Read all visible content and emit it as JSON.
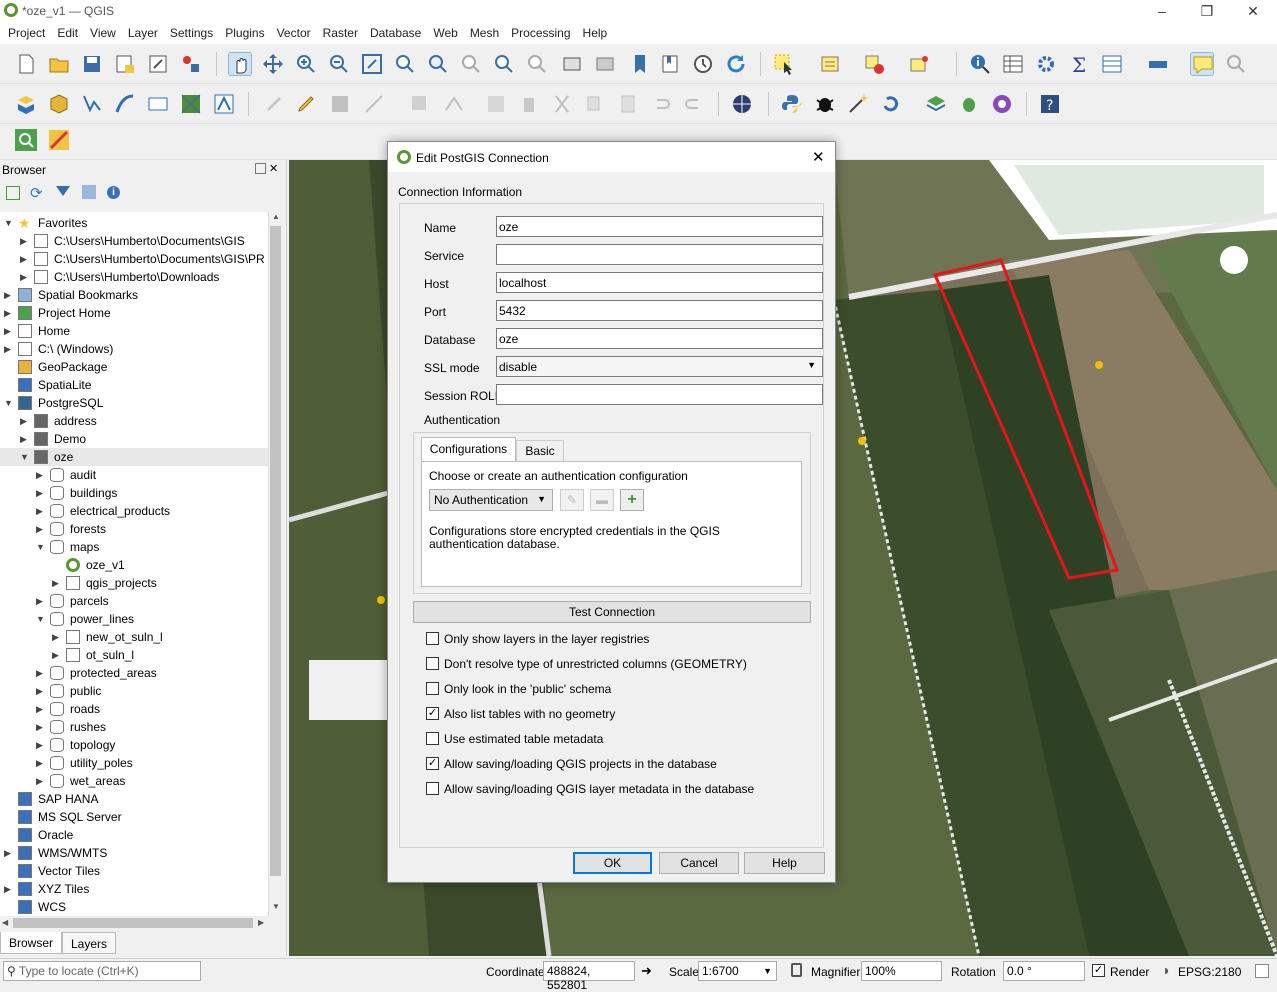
{
  "window": {
    "title": "*oze_v1 — QGIS"
  },
  "menu": [
    "Project",
    "Edit",
    "View",
    "Layer",
    "Settings",
    "Plugins",
    "Vector",
    "Raster",
    "Database",
    "Web",
    "Mesh",
    "Processing",
    "Help"
  ],
  "browser": {
    "title": "Browser",
    "items": [
      {
        "label": "Favorites",
        "depth": 0,
        "arrow": "down",
        "icon": "star-icon"
      },
      {
        "label": "C:\\Users\\Humberto\\Documents\\GIS",
        "depth": 1,
        "arrow": "right",
        "icon": "folder-icon"
      },
      {
        "label": "C:\\Users\\Humberto\\Documents\\GIS\\PR",
        "depth": 1,
        "arrow": "right",
        "icon": "folder-icon"
      },
      {
        "label": "C:\\Users\\Humberto\\Downloads",
        "depth": 1,
        "arrow": "right",
        "icon": "folder-icon"
      },
      {
        "label": "Spatial Bookmarks",
        "depth": 0,
        "arrow": "right",
        "icon": "bookmark-icon"
      },
      {
        "label": "Project Home",
        "depth": 0,
        "arrow": "right",
        "icon": "project-home-icon"
      },
      {
        "label": "Home",
        "depth": 0,
        "arrow": "right",
        "icon": "folder-icon"
      },
      {
        "label": "C:\\ (Windows)",
        "depth": 0,
        "arrow": "right",
        "icon": "folder-icon"
      },
      {
        "label": "GeoPackage",
        "depth": 0,
        "arrow": "",
        "icon": "geopackage-icon"
      },
      {
        "label": "SpatiaLite",
        "depth": 0,
        "arrow": "",
        "icon": "spatialite-icon"
      },
      {
        "label": "PostgreSQL",
        "depth": 0,
        "arrow": "down",
        "icon": "postgresql-icon"
      },
      {
        "label": "address",
        "depth": 1,
        "arrow": "right",
        "icon": "connection-icon"
      },
      {
        "label": "Demo",
        "depth": 1,
        "arrow": "right",
        "icon": "connection-icon"
      },
      {
        "label": "oze",
        "depth": 1,
        "arrow": "down",
        "icon": "connection-icon",
        "selected": true
      },
      {
        "label": "audit",
        "depth": 2,
        "arrow": "right",
        "icon": "schema-icon"
      },
      {
        "label": "buildings",
        "depth": 2,
        "arrow": "right",
        "icon": "schema-icon"
      },
      {
        "label": "electrical_products",
        "depth": 2,
        "arrow": "right",
        "icon": "schema-icon"
      },
      {
        "label": "forests",
        "depth": 2,
        "arrow": "right",
        "icon": "schema-icon"
      },
      {
        "label": "maps",
        "depth": 2,
        "arrow": "down",
        "icon": "schema-icon"
      },
      {
        "label": "oze_v1",
        "depth": 3,
        "arrow": "",
        "icon": "qgis-project-icon"
      },
      {
        "label": "qgis_projects",
        "depth": 3,
        "arrow": "right",
        "icon": "table-icon"
      },
      {
        "label": "parcels",
        "depth": 2,
        "arrow": "right",
        "icon": "schema-icon"
      },
      {
        "label": "power_lines",
        "depth": 2,
        "arrow": "down",
        "icon": "schema-icon"
      },
      {
        "label": "new_ot_suln_l",
        "depth": 3,
        "arrow": "right",
        "icon": "line-layer-icon"
      },
      {
        "label": "ot_suln_l",
        "depth": 3,
        "arrow": "right",
        "icon": "line-layer-icon"
      },
      {
        "label": "protected_areas",
        "depth": 2,
        "arrow": "right",
        "icon": "schema-icon"
      },
      {
        "label": "public",
        "depth": 2,
        "arrow": "right",
        "icon": "schema-icon"
      },
      {
        "label": "roads",
        "depth": 2,
        "arrow": "right",
        "icon": "schema-icon"
      },
      {
        "label": "rushes",
        "depth": 2,
        "arrow": "right",
        "icon": "schema-icon"
      },
      {
        "label": "topology",
        "depth": 2,
        "arrow": "right",
        "icon": "schema-icon"
      },
      {
        "label": "utility_poles",
        "depth": 2,
        "arrow": "right",
        "icon": "schema-icon"
      },
      {
        "label": "wet_areas",
        "depth": 2,
        "arrow": "right",
        "icon": "schema-icon"
      },
      {
        "label": "SAP HANA",
        "depth": 0,
        "arrow": "",
        "icon": "sap-hana-icon"
      },
      {
        "label": "MS SQL Server",
        "depth": 0,
        "arrow": "",
        "icon": "mssql-icon"
      },
      {
        "label": "Oracle",
        "depth": 0,
        "arrow": "",
        "icon": "oracle-icon"
      },
      {
        "label": "WMS/WMTS",
        "depth": 0,
        "arrow": "right",
        "icon": "wms-icon"
      },
      {
        "label": "Vector Tiles",
        "depth": 0,
        "arrow": "",
        "icon": "vector-tiles-icon"
      },
      {
        "label": "XYZ Tiles",
        "depth": 0,
        "arrow": "right",
        "icon": "xyz-tiles-icon"
      },
      {
        "label": "WCS",
        "depth": 0,
        "arrow": "",
        "icon": "wcs-icon"
      }
    ]
  },
  "panel_tabs": [
    "Browser",
    "Layers"
  ],
  "dialog": {
    "title": "Edit PostGIS Connection",
    "section": "Connection Information",
    "fields": [
      {
        "label": "Name",
        "value": "oze"
      },
      {
        "label": "Service",
        "value": ""
      },
      {
        "label": "Host",
        "value": "localhost"
      },
      {
        "label": "Port",
        "value": "5432"
      },
      {
        "label": "Database",
        "value": "oze"
      },
      {
        "label": "SSL mode",
        "value": "disable"
      },
      {
        "label": "Session ROLE",
        "value": ""
      }
    ],
    "auth": {
      "label": "Authentication",
      "tabs": [
        "Configurations",
        "Basic"
      ],
      "choose_label": "Choose or create an authentication configuration",
      "select_value": "No Authentication",
      "note": "Configurations store encrypted credentials in the QGIS authentication database."
    },
    "test_button": "Test Connection",
    "options": [
      {
        "label": "Only show layers in the layer registries",
        "checked": false
      },
      {
        "label": "Don't resolve type of unrestricted columns (GEOMETRY)",
        "checked": false
      },
      {
        "label": "Only look in the 'public' schema",
        "checked": false
      },
      {
        "label": "Also list tables with no geometry",
        "checked": true
      },
      {
        "label": "Use estimated table metadata",
        "checked": false
      },
      {
        "label": "Allow saving/loading QGIS projects in the database",
        "checked": true
      },
      {
        "label": "Allow saving/loading QGIS layer metadata in the database",
        "checked": false
      }
    ],
    "buttons": {
      "ok": "OK",
      "cancel": "Cancel",
      "help": "Help"
    }
  },
  "status": {
    "locate_placeholder": "Type to locate (Ctrl+K)",
    "coordinate_label": "Coordinate",
    "coordinate": "488824, 552801",
    "scale_label": "Scale",
    "scale": "1:6700",
    "magnifier_label": "Magnifier",
    "magnifier": "100%",
    "rotation_label": "Rotation",
    "rotation": "0.0 °",
    "render_label": "Render",
    "crs": "EPSG:2180"
  }
}
